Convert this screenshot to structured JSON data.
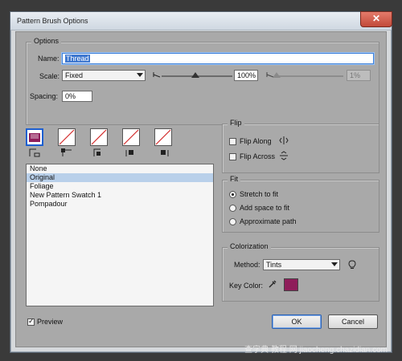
{
  "window": {
    "title": "Pattern Brush Options",
    "close_label": "✕"
  },
  "options": {
    "legend": "Options",
    "name_label": "Name:",
    "name_value": "Thread",
    "scale_label": "Scale:",
    "scale_value": "Fixed",
    "scale_percent": "100%",
    "scale_percent2": "1%",
    "spacing_label": "Spacing:",
    "spacing_value": "0%"
  },
  "tiles": {
    "active_color": "#8f1d5a",
    "slash_color": "#d22a2a"
  },
  "pattern_list": {
    "items": [
      "None",
      "Original",
      "Foliage",
      "New Pattern Swatch 1",
      "Pompadour"
    ],
    "selected_index": 1
  },
  "flip": {
    "legend": "Flip",
    "along_label": "Flip Along",
    "across_label": "Flip Across"
  },
  "fit": {
    "legend": "Fit",
    "options": [
      "Stretch to fit",
      "Add space to fit",
      "Approximate path"
    ],
    "selected_index": 0
  },
  "colorization": {
    "legend": "Colorization",
    "method_label": "Method:",
    "method_value": "Tints",
    "key_color_label": "Key Color:",
    "key_color": "#8f1d5a"
  },
  "footer": {
    "preview_label": "Preview",
    "ok_label": "OK",
    "cancel_label": "Cancel"
  },
  "watermark": "查字典 教程 网 jiaocheng.chazidian.com"
}
